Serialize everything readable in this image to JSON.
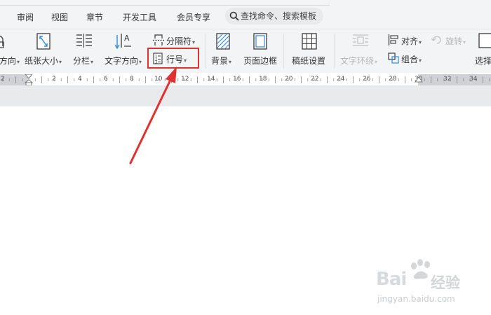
{
  "menu_tabs": [
    "审阅",
    "视图",
    "章节",
    "开发工具",
    "会员专享"
  ],
  "search": {
    "text": "查找命令、搜索模板"
  },
  "ribbon": {
    "direction": "方向",
    "paper_size": "纸张大小",
    "columns": "分栏",
    "text_direction": "文字方向",
    "separator": "分隔符",
    "line_number": "行号",
    "background": "背景",
    "page_border": "页面边框",
    "manuscript": "稿纸设置",
    "text_wrap": "文字环绕",
    "align": "对齐",
    "rotate": "旋转",
    "group": "组合",
    "select": "选择"
  },
  "ruler_numbers": [
    "2",
    "2",
    "4",
    "6",
    "8",
    "10",
    "12",
    "14",
    "16",
    "18",
    "20",
    "22",
    "24",
    "26",
    "28",
    "30",
    "32",
    "34"
  ],
  "watermark": {
    "brand": "Bai",
    "brand_cn": "经验",
    "site": "jingyan.baidu.com"
  },
  "colors": {
    "highlight": "#e0312f",
    "ribbon_bg": "#f3f4f6",
    "ruler_grey": "#cfd1d4"
  }
}
